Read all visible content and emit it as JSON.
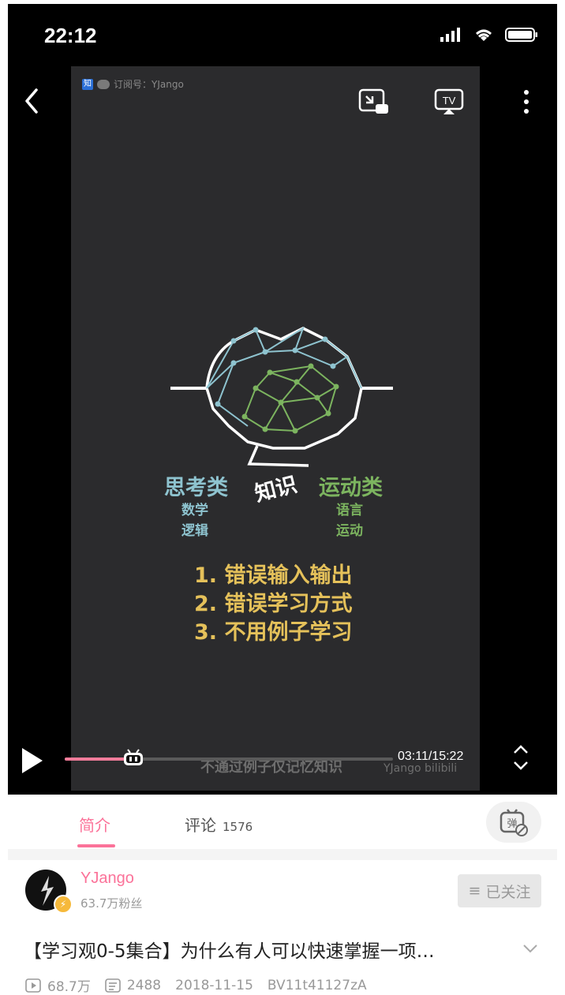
{
  "status_bar": {
    "time": "22:12"
  },
  "video": {
    "watermark_top": "订阅号：YJango",
    "labels": {
      "think_category": "思考类",
      "knowledge": "知识",
      "move_category": "运动类",
      "think_items": [
        "数学",
        "逻辑"
      ],
      "move_items": [
        "语言",
        "运动"
      ]
    },
    "reasons": [
      "1. 错误输入输出",
      "2. 错误学习方式",
      "3. 不用例子学习"
    ],
    "subtitle": "不通过例子仅记忆知识",
    "watermark_bottom": "YJango bilibili",
    "colors": {
      "think": "#8ec3cf",
      "move": "#7cb45f",
      "reasons": "#e5c15a",
      "progress": "#f07c9a"
    }
  },
  "player_controls": {
    "time_readout": "03:11/15:22",
    "progress_fraction": 0.207,
    "icons": [
      "back-icon",
      "picture-in-picture-icon",
      "tv-cast-icon",
      "more-icon",
      "play-icon",
      "expand-icon"
    ]
  },
  "tabs": {
    "intro_label": "简介",
    "comments_label": "评论",
    "comments_count": "1576",
    "danmaku_icon": "danmaku-off-icon"
  },
  "uploader": {
    "name": "YJango",
    "fans": "63.7万粉丝",
    "follow_label": "已关注"
  },
  "video_info": {
    "title": "【学习观0-5集合】为什么有人可以快速掌握一项…",
    "views": "68.7万",
    "danmaku_count": "2488",
    "date": "2018-11-15",
    "bvid": "BV11t41127zA"
  }
}
